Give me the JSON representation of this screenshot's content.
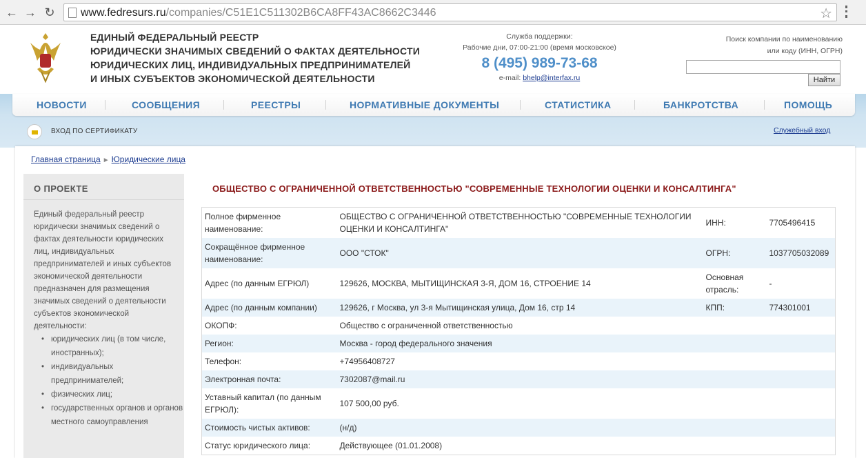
{
  "browser": {
    "url_host": "www.fedresurs.ru",
    "url_path": "/companies/C51E1C511302B6CA8FF43AC8662C3446"
  },
  "header": {
    "title_lines": [
      "ЕДИНЫЙ ФЕДЕРАЛЬНЫЙ РЕЕСТР",
      "ЮРИДИЧЕСКИ ЗНАЧИМЫХ СВЕДЕНИЙ О ФАКТАХ ДЕЯТЕЛЬНОСТИ",
      "ЮРИДИЧЕСКИХ ЛИЦ, ИНДИВИДУАЛЬНЫХ ПРЕДПРИНИМАТЕЛЕЙ",
      "И ИНЫХ СУБЪЕКТОВ ЭКОНОМИЧЕСКОЙ ДЕЯТЕЛЬНОСТИ"
    ],
    "support_label": "Служба поддержки:",
    "support_hours": "Рабочие дни, 07:00-21:00 (время московское)",
    "phone": "8 (495) 989-73-68",
    "email_label": "e-mail:",
    "email": "bhelp@interfax.ru",
    "search_label_1": "Поиск компании по наименованию",
    "search_label_2": "или коду (ИНН, ОГРН)",
    "search_button": "Найти"
  },
  "menu": {
    "items": [
      "НОВОСТИ",
      "СООБЩЕНИЯ",
      "РЕЕСТРЫ",
      "НОРМАТИВНЫЕ ДОКУМЕНТЫ",
      "СТАТИСТИКА",
      "БАНКРОТСТВА",
      "ПОМОЩЬ"
    ],
    "cert_login": "ВХОД ПО СЕРТИФИКАТУ",
    "service_login": "Служебный вход"
  },
  "breadcrumb": {
    "home": "Главная страница",
    "current": "Юридические лица"
  },
  "sidebar": {
    "title": "О ПРОЕКТЕ",
    "text": "Единый федеральный реестр юридически значимых сведений о фактах деятельности юридических лиц, индивидуальных предпринимателей и иных субъектов экономической деятельности предназначен для размещения значимых сведений о деятельности субъектов экономической деятельности:",
    "list": [
      "юридических лиц (в том числе, иностранных);",
      "индивидуальных предпринимателей;",
      "физических лиц;",
      "государственных органов и органов местного самоуправления"
    ]
  },
  "company": {
    "title": "ОБЩЕСТВО С ОГРАНИЧЕННОЙ ОТВЕТСТВЕННОСТЬЮ \"СОВРЕМЕННЫЕ ТЕХНОЛОГИИ ОЦЕНКИ И КОНСАЛТИНГА\"",
    "rows": [
      {
        "label": "Полное фирменное наименование:",
        "value": "ОБЩЕСТВО С ОГРАНИЧЕННОЙ ОТВЕТСТВЕННОСТЬЮ \"СОВРЕМЕННЫЕ ТЕХНОЛОГИИ ОЦЕНКИ И КОНСАЛТИНГА\"",
        "label2": "ИНН:",
        "value2": "7705496415"
      },
      {
        "label": "Сокращённое фирменное наименование:",
        "value": "ООО \"СТОК\"",
        "label2": "ОГРН:",
        "value2": "1037705032089"
      },
      {
        "label": "Адрес (по данным ЕГРЮЛ)",
        "value": "129626, МОСКВА, МЫТИЩИНСКАЯ 3-Я, ДОМ 16, СТРОЕНИЕ 14",
        "label2": "Основная отрасль:",
        "value2": "-"
      },
      {
        "label": "Адрес (по данным компании)",
        "value": "129626, г Москва, ул 3-я Мытищинская улица, Дом 16, стр 14",
        "label2": "КПП:",
        "value2": "774301001"
      },
      {
        "label": "ОКОПФ:",
        "value": "Общество с ограниченной ответственностью",
        "label2": "",
        "value2": ""
      },
      {
        "label": "Регион:",
        "value": "Москва - город федерального значения",
        "label2": "",
        "value2": ""
      },
      {
        "label": "Телефон:",
        "value": "+74956408727",
        "label2": "",
        "value2": ""
      },
      {
        "label": "Электронная почта:",
        "value": "7302087@mail.ru",
        "label2": "",
        "value2": ""
      },
      {
        "label": "Уставный капитал (по данным ЕГРЮЛ):",
        "value": "107 500,00 руб.",
        "label2": "",
        "value2": ""
      },
      {
        "label": "Стоимость чистых активов:",
        "value": "(н/д)",
        "label2": "",
        "value2": ""
      },
      {
        "label": "Статус юридического лица:",
        "value": "Действующее (01.01.2008)",
        "label2": "",
        "value2": ""
      }
    ]
  }
}
